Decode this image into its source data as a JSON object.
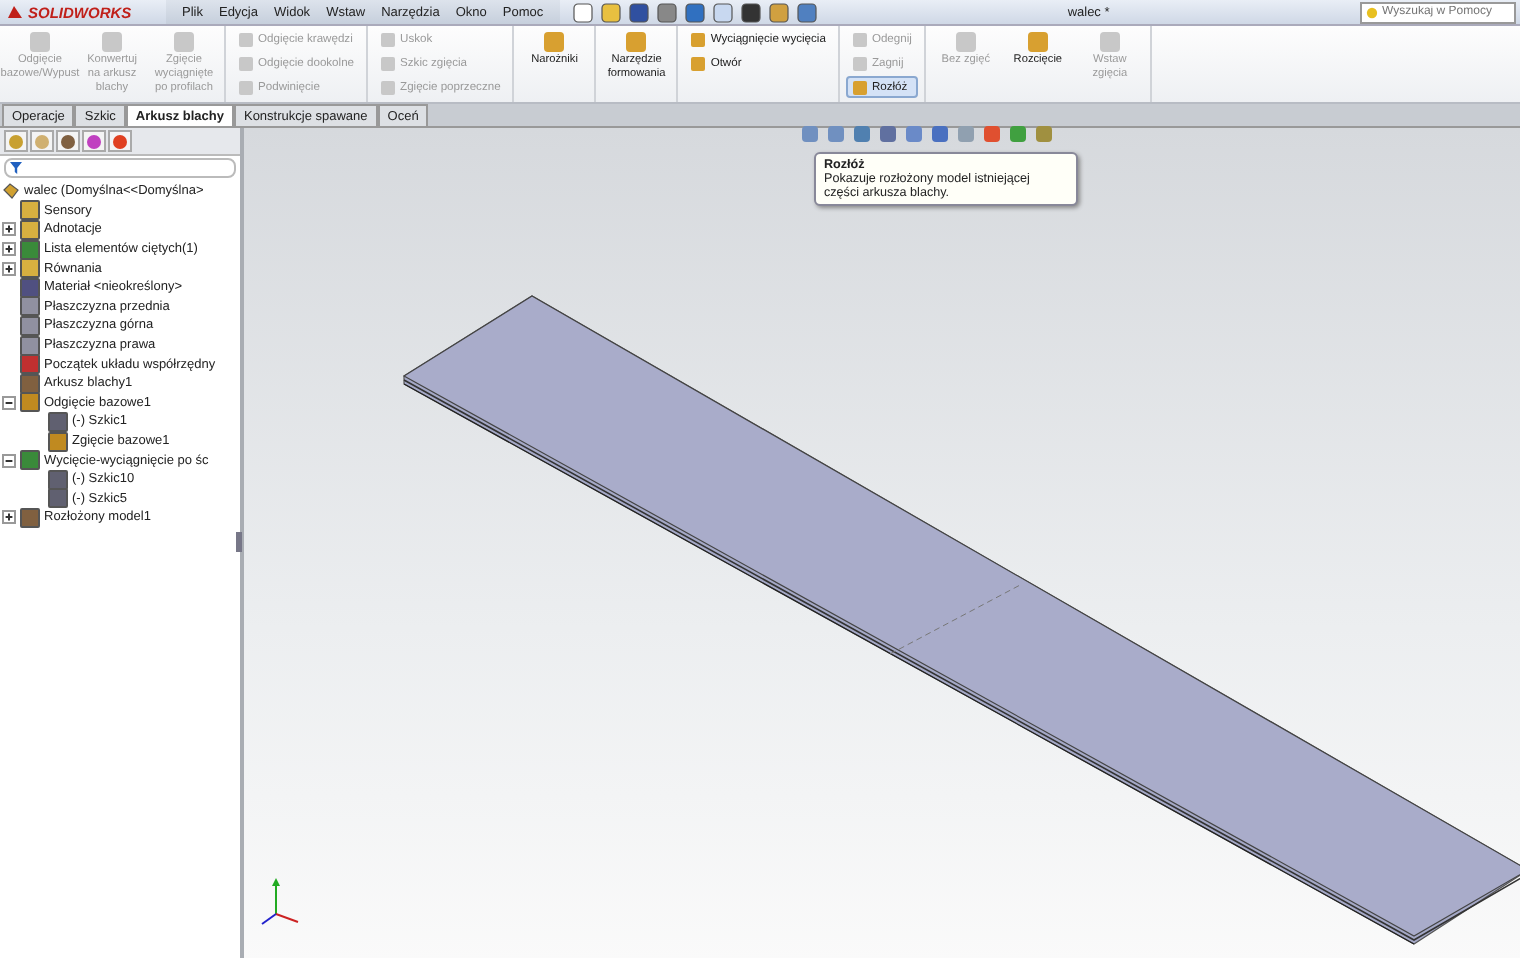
{
  "app": {
    "logo": "SOLIDWORKS",
    "menu": [
      "Plik",
      "Edycja",
      "Widok",
      "Wstaw",
      "Narzędzia",
      "Okno",
      "Pomoc"
    ],
    "document_title": "walec *",
    "search": {
      "placeholder": "Wyszukaj w Pomocy"
    }
  },
  "ribbon": {
    "groups": [
      {
        "kind": "large",
        "items": [
          {
            "label": "Odgięcie bazowe/Wypust",
            "disabled": true,
            "active": false
          },
          {
            "label": "Konwertuj na arkusz blachy",
            "disabled": true,
            "active": false
          },
          {
            "label": "Zgięcie wyciągnięte po profilach",
            "disabled": true,
            "active": false
          }
        ]
      },
      {
        "kind": "small",
        "items": [
          {
            "label": "Odgięcie krawędzi",
            "disabled": true,
            "active": false
          },
          {
            "label": "Odgięcie dookolne",
            "disabled": true,
            "active": false
          },
          {
            "label": "Podwinięcie",
            "disabled": true,
            "active": false
          }
        ]
      },
      {
        "kind": "small",
        "items": [
          {
            "label": "Uskok",
            "disabled": true,
            "active": false
          },
          {
            "label": "Szkic zgięcia",
            "disabled": true,
            "active": false
          },
          {
            "label": "Zgięcie poprzeczne",
            "disabled": true,
            "active": false
          }
        ]
      },
      {
        "kind": "large",
        "items": [
          {
            "label": "Narożniki",
            "disabled": false,
            "active": false
          }
        ]
      },
      {
        "kind": "large",
        "items": [
          {
            "label": "Narzędzie formowania",
            "disabled": false,
            "active": false
          }
        ]
      },
      {
        "kind": "small",
        "items": [
          {
            "label": "Wyciągnięcie wycięcia",
            "disabled": false,
            "active": false
          },
          {
            "label": "Otwór",
            "disabled": false,
            "active": false
          }
        ]
      },
      {
        "kind": "small",
        "items": [
          {
            "label": "Odegnij",
            "disabled": true,
            "active": false
          },
          {
            "label": "Zagnij",
            "disabled": true,
            "active": false
          },
          {
            "label": "Rozłóż",
            "disabled": false,
            "active": true
          }
        ]
      },
      {
        "kind": "large",
        "items": [
          {
            "label": "Bez zgięć",
            "disabled": true,
            "active": false
          },
          {
            "label": "Rozcięcie",
            "disabled": false,
            "active": false
          },
          {
            "label": "Wstaw zgięcia",
            "disabled": true,
            "active": false
          }
        ]
      }
    ]
  },
  "tabs": [
    {
      "label": "Operacje",
      "selected": false
    },
    {
      "label": "Szkic",
      "selected": false
    },
    {
      "label": "Arkusz blachy",
      "selected": true
    },
    {
      "label": "Konstrukcje spawane",
      "selected": false
    },
    {
      "label": "Oceń",
      "selected": false
    }
  ],
  "feature_tree": {
    "root": "walec  (Domyślna<<Domyślna>",
    "items": [
      {
        "label": "Sensory",
        "color": "#d8b040"
      },
      {
        "label": "Adnotacje",
        "color": "#d8b040",
        "expanded": false
      },
      {
        "label": "Lista elementów ciętych(1)",
        "color": "#3a8a3a",
        "expanded": false
      },
      {
        "label": "Równania",
        "color": "#d8b040",
        "expanded": false
      },
      {
        "label": "Materiał <nieokreślony>",
        "color": "#505080"
      },
      {
        "label": "Płaszczyzna przednia",
        "color": "#9090a0"
      },
      {
        "label": "Płaszczyzna górna",
        "color": "#9090a0"
      },
      {
        "label": "Płaszczyzna prawa",
        "color": "#9090a0"
      },
      {
        "label": "Początek układu współrzędny",
        "color": "#c03030"
      },
      {
        "label": "Arkusz blachy1",
        "color": "#806040"
      },
      {
        "label": "Odgięcie bazowe1",
        "color": "#c08a20",
        "expanded": true,
        "children": [
          {
            "label": "(-) Szkic1",
            "color": "#606070"
          },
          {
            "label": "Zgięcie bazowe1",
            "color": "#c08a20"
          }
        ]
      },
      {
        "label": "Wycięcie-wyciągnięcie po śc",
        "color": "#3a8a3a",
        "expanded": true,
        "children": [
          {
            "label": "(-) Szkic10",
            "color": "#606070"
          },
          {
            "label": "(-) Szkic5",
            "color": "#606070"
          }
        ]
      },
      {
        "label": "Rozłożony model1",
        "color": "#806040",
        "expanded": false
      }
    ]
  },
  "tooltip": {
    "title": "Rozłóż",
    "text": "Pokazuje rozłożony model istniejącej części arkusza blachy."
  }
}
